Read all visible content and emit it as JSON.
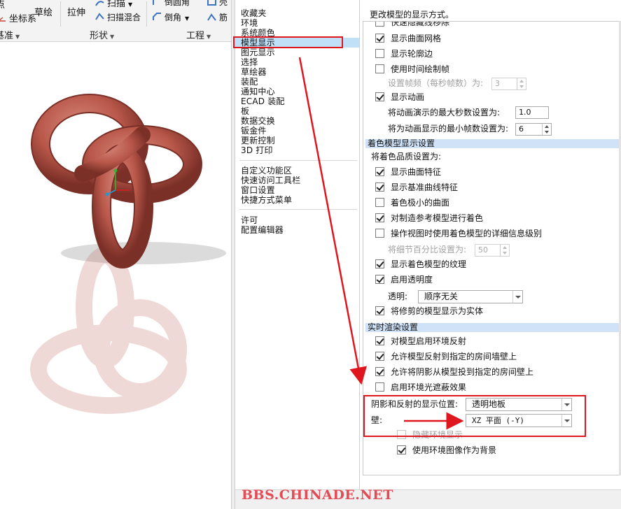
{
  "ribbon": {
    "sketch": "草绘",
    "extrude": "拉伸",
    "sweep": "扫描",
    "swept_blend": "扫描混合",
    "round": "倒圆角",
    "chamfer": "倒角",
    "coord_sys": "坐标系",
    "point_frag": "点",
    "rib_frag": "筋",
    "shell_frag": "壳",
    "groups": {
      "datum": "基准",
      "shapes": "形状",
      "engineering": "工程"
    }
  },
  "categories": {
    "group1": [
      "收藏夹",
      "环境",
      "系统颜色",
      "模型显示",
      "图元显示",
      "选择",
      "草绘器",
      "装配",
      "通知中心",
      "ECAD 装配",
      "板",
      "数据交换",
      "钣金件",
      "更新控制",
      "3D 打印"
    ],
    "group2": [
      "自定义功能区",
      "快速访问工具栏",
      "窗口设置",
      "快捷方式菜单"
    ],
    "group3": [
      "许可",
      "配置编辑器"
    ],
    "selected_index": 3
  },
  "settings": {
    "title": "更改模型的显示方式。",
    "model_display": {
      "partial_top": "快速隐藏线移除",
      "show_surface_mesh": {
        "label": "显示曲面网格",
        "checked": true
      },
      "show_silhouette": {
        "label": "显示轮廓边",
        "checked": false
      },
      "use_timed_draw": {
        "label": "使用时间绘制帧",
        "checked": false
      },
      "frame_rate": {
        "label": "设置帧频（每秒帧数）为:",
        "value": "3"
      },
      "show_animation": {
        "label": "显示动画",
        "checked": true
      },
      "max_seconds": {
        "label": "将动画演示的最大秒数设置为:",
        "value": "1.0"
      },
      "min_frames": {
        "label": "将为动画显示的最小帧数设置为:",
        "value": "6"
      }
    },
    "shaded": {
      "header": "着色模型显示设置",
      "quality_label": "将着色品质设置为:",
      "show_surface_features": {
        "label": "显示曲面特征",
        "checked": true
      },
      "show_datum_curves": {
        "label": "显示基准曲线特征",
        "checked": true
      },
      "shade_small_surfaces": {
        "label": "着色极小的曲面",
        "checked": false
      },
      "shade_mfg_ref": {
        "label": "对制造参考模型进行着色",
        "checked": true
      },
      "detail_level_on_manipulate": {
        "label": "操作视图时使用着色模型的详细信息级别",
        "checked": false
      },
      "detail_percent": {
        "label": "将细节百分比设置为:",
        "value": "50"
      },
      "show_texture": {
        "label": "显示着色模型的纹理",
        "checked": true
      },
      "enable_transparency": {
        "label": "启用透明度",
        "checked": true
      },
      "transparency": {
        "label": "透明:",
        "value": "顺序无关"
      },
      "trimmed_as_solid": {
        "label": "将修剪的模型显示为实体",
        "checked": true
      }
    },
    "realtime": {
      "header": "实时渲染设置",
      "env_reflection": {
        "label": "对模型启用环境反射",
        "checked": true
      },
      "reflect_to_wall": {
        "label": "允许模型反射到指定的房间墙壁上",
        "checked": true
      },
      "shadow_to_wall": {
        "label": "允许将阴影从模型投到指定的房间壁上",
        "checked": true
      },
      "ambient_occlusion": {
        "label": "启用环境光遮蔽效果",
        "checked": false
      },
      "shadow_position": {
        "label": "阴影和反射的显示位置:",
        "value": "透明地板"
      },
      "wall": {
        "label": "壁:",
        "value": "XZ 平面 (-Y)"
      },
      "hide_environment": {
        "label": "隐藏环境显示",
        "checked": false
      },
      "env_image_background": {
        "label": "使用环境图像作为背景",
        "checked": true
      }
    }
  },
  "watermark": "BBS.CHINADE.NET",
  "colors": {
    "selection": "#bfe0f7",
    "section_header": "#cfe2f7",
    "annotation_red": "#e0161e",
    "knot": "#b8574a",
    "watermark": "#e34b55"
  }
}
